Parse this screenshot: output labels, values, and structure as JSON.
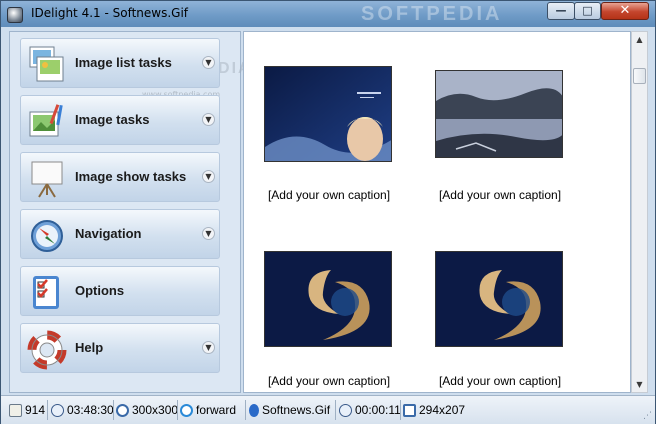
{
  "window": {
    "title": "IDelight 4.1 - Softnews.Gif",
    "watermark": "SOFTPEDIA",
    "controls": {
      "minimize": "—",
      "maximize": "□",
      "close": "✕"
    }
  },
  "sidepanel": {
    "watermark": "SOFTPEDIA",
    "watermark_url": "www.softpedia.com",
    "tasks": [
      {
        "label": "Image list tasks",
        "icon": "image-list-icon",
        "expandable": true
      },
      {
        "label": "Image tasks",
        "icon": "image-edit-icon",
        "expandable": true
      },
      {
        "label": "Image show tasks",
        "icon": "slideshow-easel-icon",
        "expandable": true
      },
      {
        "label": "Navigation",
        "icon": "compass-icon",
        "expandable": true
      },
      {
        "label": "Options",
        "icon": "checklist-icon",
        "expandable": false
      },
      {
        "label": "Help",
        "icon": "lifebuoy-icon",
        "expandable": true
      }
    ]
  },
  "thumbnails": [
    {
      "caption": "[Add your own caption]",
      "image": "softnews-woman"
    },
    {
      "caption": "[Add your own caption]",
      "image": "beach-landscape"
    },
    {
      "caption": "[Add your own caption]",
      "image": "softnews-swirl"
    },
    {
      "caption": "[Add your own caption]",
      "image": "softnews-swirl"
    }
  ],
  "statusbar": {
    "count": "914",
    "time": "03:48:30",
    "size": "300x300",
    "direction": "forward",
    "filename": "Softnews.Gif",
    "duration": "00:00:11",
    "dimensions": "294x207"
  },
  "colors": {
    "titlebar": "#7aa3cd",
    "panel": "#dce7f3",
    "thumb_dark": "#0f1e4a"
  }
}
